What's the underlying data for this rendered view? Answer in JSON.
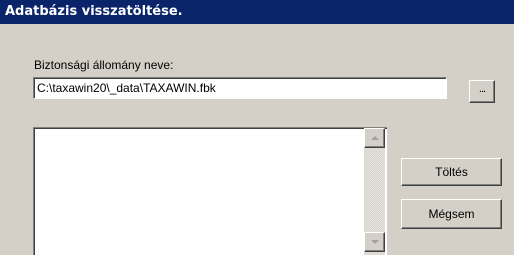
{
  "window": {
    "title": "Adatbázis visszatöltése."
  },
  "form": {
    "file_label": "Biztonsági állomány neve:",
    "file_path": "C:\\taxawin20\\_data\\TAXAWIN.fbk",
    "browse_label": "..."
  },
  "actions": {
    "load_label": "Töltés",
    "cancel_label": "Mégsem"
  },
  "colors": {
    "title_bar": "#0a246a",
    "window_bg": "#d4d0c8"
  },
  "icons": {
    "scroll_up": "triangle-up",
    "scroll_down": "triangle-down"
  }
}
